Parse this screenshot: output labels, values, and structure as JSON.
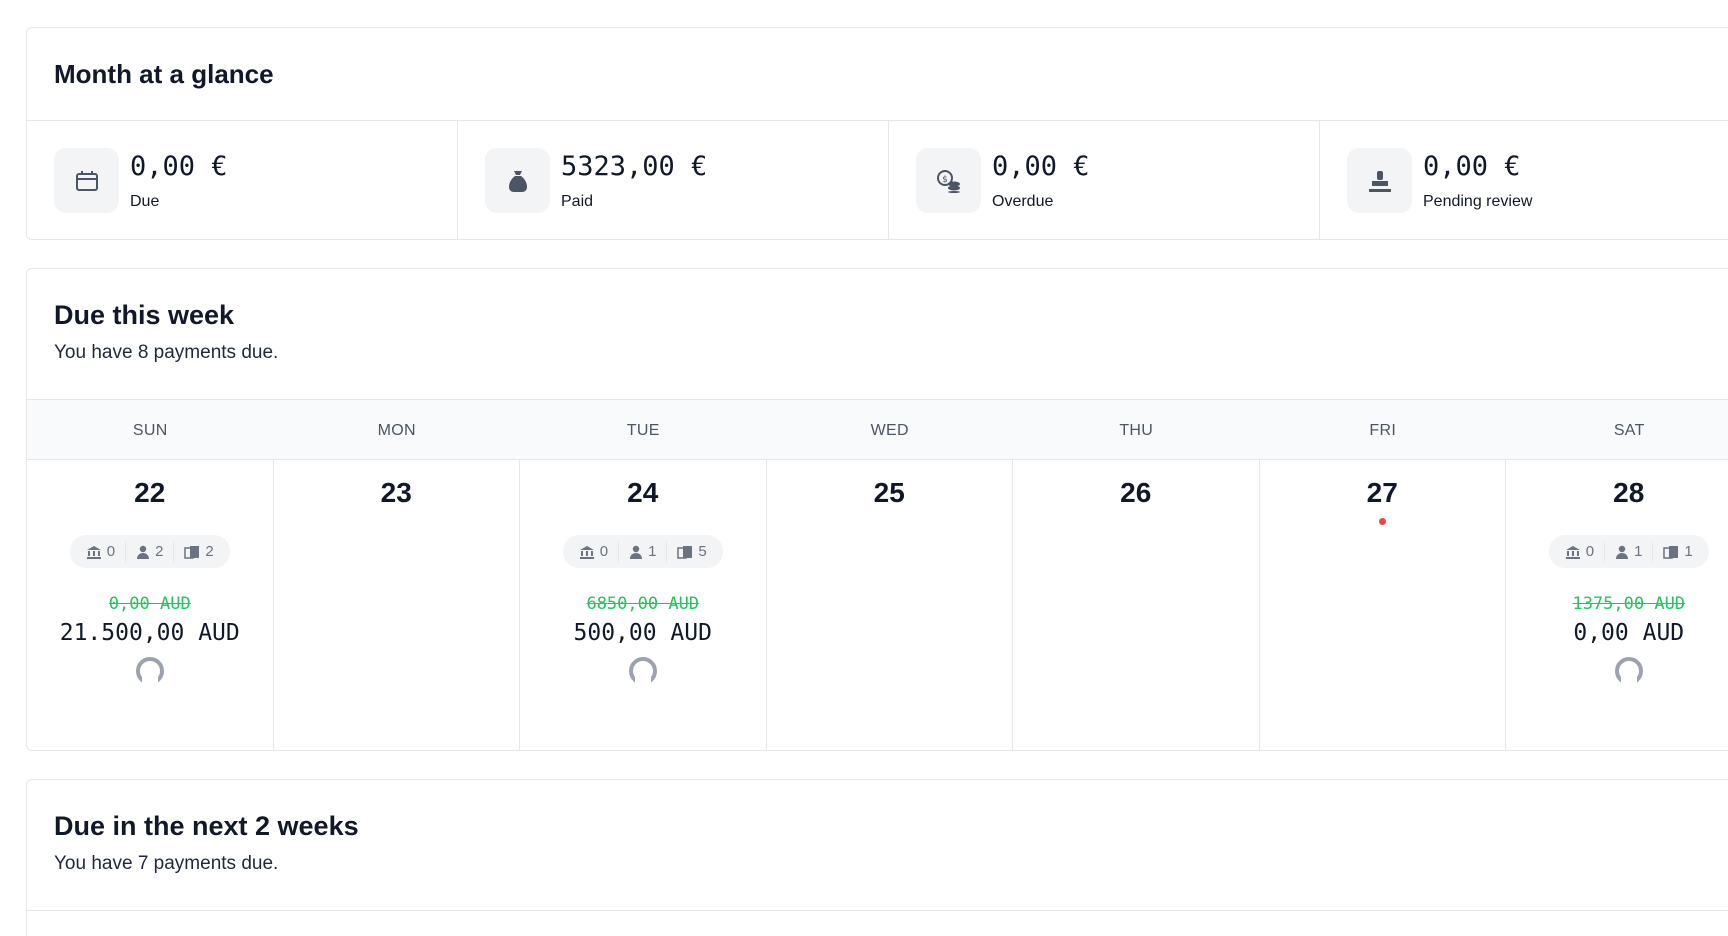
{
  "glance": {
    "title": "Month at a glance",
    "stats": [
      {
        "value": "0,00 €",
        "label": "Due",
        "icon": "calendar-icon"
      },
      {
        "value": "5323,00 €",
        "label": "Paid",
        "icon": "money-bag-icon"
      },
      {
        "value": "0,00 €",
        "label": "Overdue",
        "icon": "coins-icon"
      },
      {
        "value": "0,00 €",
        "label": "Pending review",
        "icon": "stamp-icon"
      }
    ]
  },
  "week": {
    "title": "Due this week",
    "subtitle": "You have 8 payments due.",
    "days": [
      {
        "head": "SUN",
        "num": "22",
        "bank": "0",
        "person": "2",
        "invoice": "2",
        "old": "0,00 AUD",
        "new": "21.500,00 AUD"
      },
      {
        "head": "MON",
        "num": "23"
      },
      {
        "head": "TUE",
        "num": "24",
        "bank": "0",
        "person": "1",
        "invoice": "5",
        "old": "6850,00 AUD",
        "new": "500,00 AUD"
      },
      {
        "head": "WED",
        "num": "25"
      },
      {
        "head": "THU",
        "num": "26"
      },
      {
        "head": "FRI",
        "num": "27",
        "today": true
      },
      {
        "head": "SAT",
        "num": "28",
        "bank": "0",
        "person": "1",
        "invoice": "1",
        "old": "1375,00 AUD",
        "new": "0,00 AUD"
      }
    ]
  },
  "twoweeks": {
    "title": "Due in the next 2 weeks",
    "subtitle": "You have 7 payments due."
  },
  "colors": {
    "paid_green": "#22c55e",
    "today_dot": "#ef4444",
    "icon_gray": "#6b7280"
  }
}
